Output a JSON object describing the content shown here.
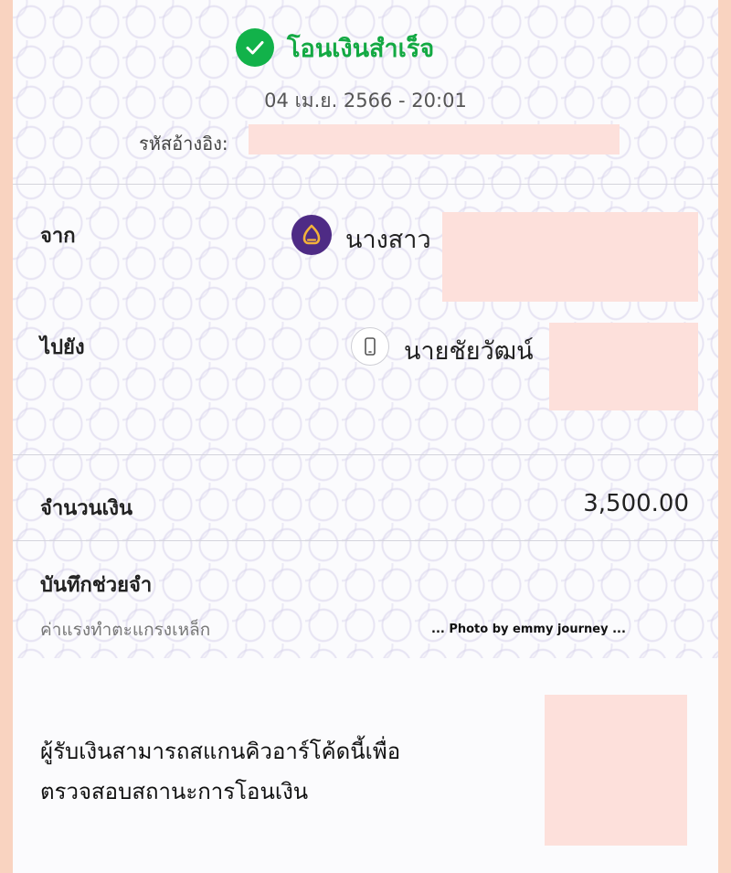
{
  "status": {
    "title": "โอนเงินสำเร็จ",
    "icon": "check-circle-icon",
    "color": "#13a943"
  },
  "datetime": "04 เม.ย. 2566 - 20:01",
  "reference": {
    "label": "รหัสอ้างอิง:"
  },
  "from": {
    "label": "จาก",
    "bank_icon": "bank-logo-icon",
    "name": "นางสาว"
  },
  "to": {
    "label": "ไปยัง",
    "icon": "mobile-phone-icon",
    "name": "นายชัยวัฒน์"
  },
  "amount": {
    "label": "จำนวนเงิน",
    "value": "3,500.00"
  },
  "memo": {
    "label": "บันทึกช่วยจำ",
    "text": "ค่าแรงทำตะแกรงเหล็ก"
  },
  "watermark": "... Photo by emmy journey ...",
  "qr_note": {
    "line1": "ผู้รับเงินสามารถสแกนคิวอาร์โค้ดนี้เพื่อ",
    "line2": "ตรวจสอบสถานะการโอนเงิน"
  }
}
